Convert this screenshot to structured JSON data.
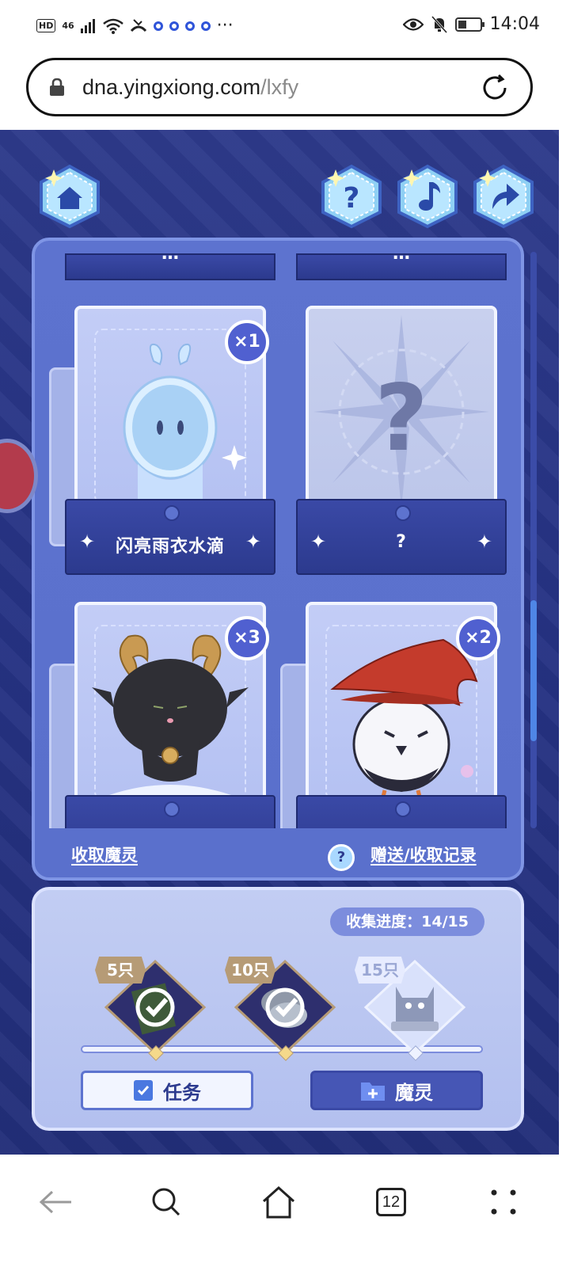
{
  "status_bar": {
    "hd": "HD",
    "network": "46",
    "more": "···",
    "time": "14:04"
  },
  "browser": {
    "url_domain": "dna.yingxiong.com",
    "url_path": "/lxfy",
    "tab_count": "12"
  },
  "top_cards": {
    "left_label": "闪亮雨衣水滴",
    "right_label": "?",
    "above_left": "…",
    "above_right": "…"
  },
  "cards": [
    {
      "label": "闪亮雨衣水滴",
      "count": "×1",
      "state": "owned"
    },
    {
      "label": "?",
      "count": "",
      "state": "unknown"
    },
    {
      "label": "",
      "count": "×3",
      "state": "owned"
    },
    {
      "label": "",
      "count": "×2",
      "state": "owned"
    }
  ],
  "panel_links": {
    "claim": "收取魔灵",
    "help": "?",
    "history": "赠送/收取记录"
  },
  "collection": {
    "progress_label": "收集进度：",
    "progress_value": "14/15",
    "progress_fraction": 0.9333,
    "milestones": [
      {
        "tag": "5只",
        "completed": true
      },
      {
        "tag": "10只",
        "completed": true
      },
      {
        "tag": "15只",
        "completed": false
      }
    ],
    "task_button": "任务",
    "spirit_button": "魔灵"
  },
  "colors": {
    "page_bg": "#2d3a8a",
    "panel": "#5d73cf",
    "accent": "#4656b5",
    "gold": "#b69b76"
  }
}
